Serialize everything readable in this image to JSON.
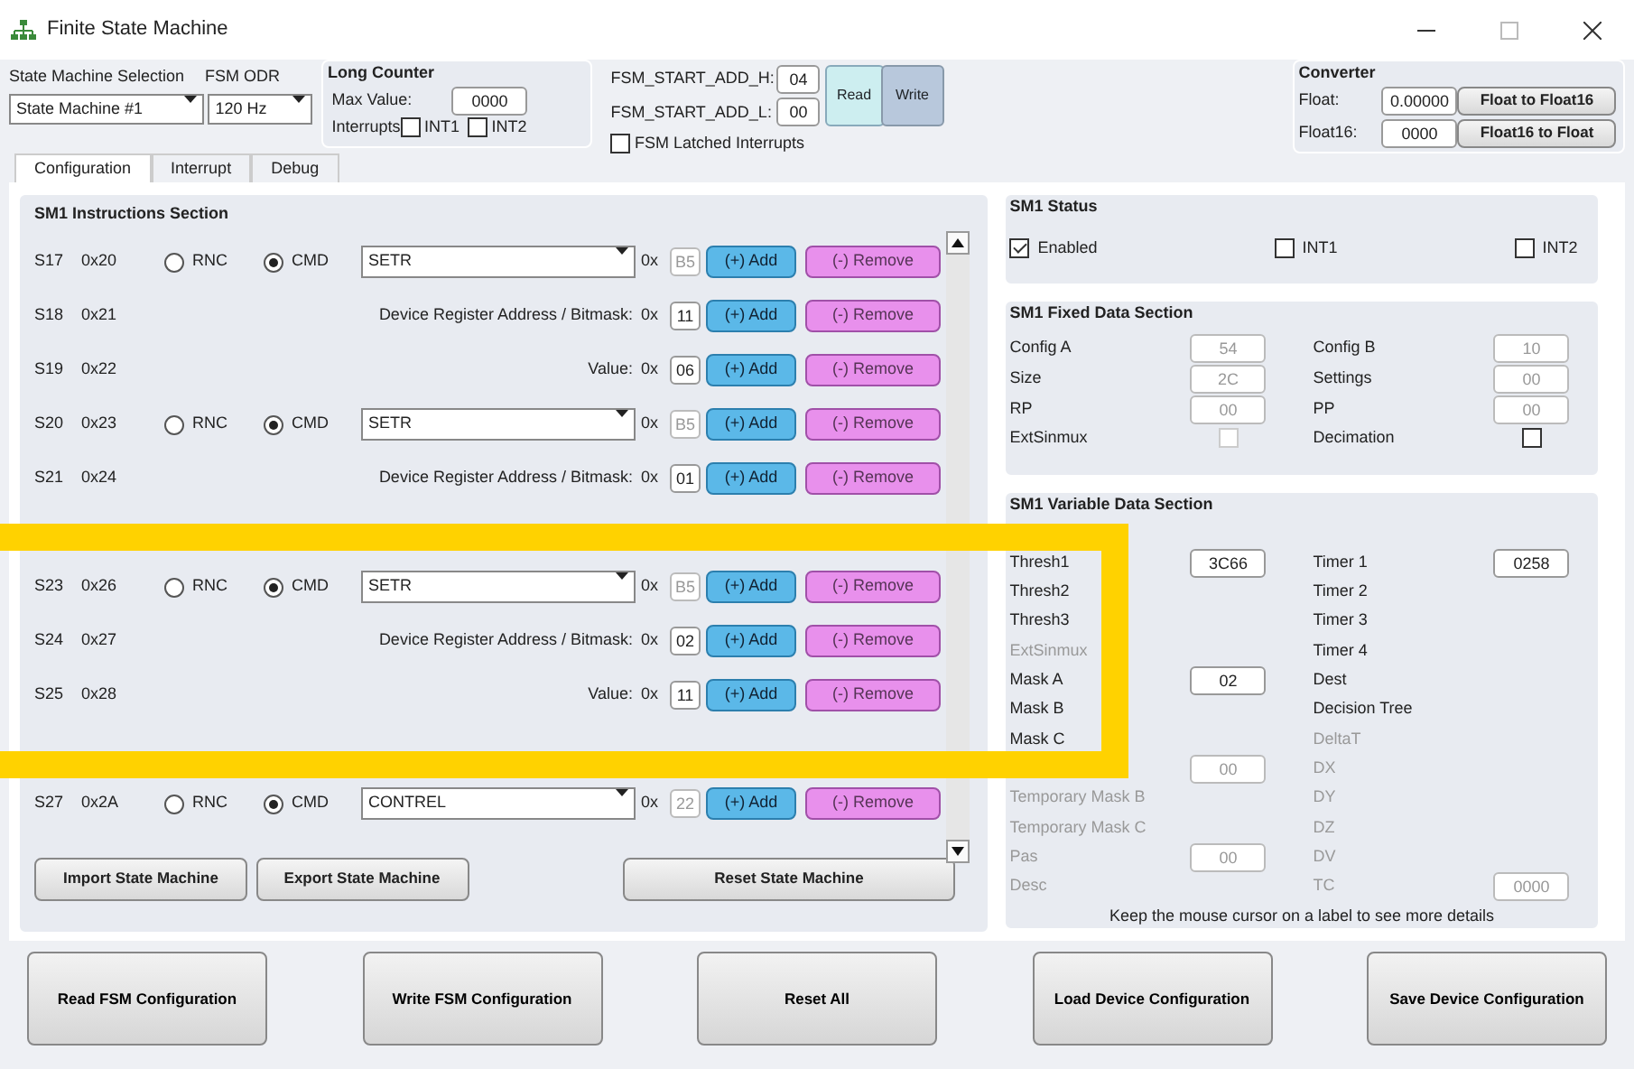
{
  "window": {
    "title": "Finite State Machine"
  },
  "top": {
    "sm_selection": {
      "label": "State Machine Selection",
      "value": "State Machine #1"
    },
    "odr": {
      "label": "FSM ODR",
      "value": "120 Hz"
    },
    "long_counter": {
      "title": "Long Counter",
      "max_label": "Max Value:",
      "max_value": "0000",
      "interrupts_label": "Interrupts",
      "checks": [
        {
          "label": "INT1",
          "checked": false
        },
        {
          "label": "INT2",
          "checked": false
        }
      ]
    },
    "fsm_start": {
      "fields": [
        {
          "label": "FSM_START_ADD_H:",
          "value": "04"
        },
        {
          "label": "FSM_START_ADD_L:",
          "value": "00"
        }
      ],
      "read_button": "Read",
      "write_button": "Write",
      "latched": {
        "label": "FSM Latched Interrupts",
        "checked": false
      }
    },
    "converter": {
      "title": "Converter",
      "rows": [
        {
          "label": "Float:",
          "value": "0.00000",
          "button": "Float to Float16"
        },
        {
          "label": "Float16:",
          "value": "0000",
          "button": "Float16 to Float"
        }
      ]
    }
  },
  "tabs": [
    {
      "label": "Configuration",
      "selected": true
    },
    {
      "label": "Interrupt",
      "selected": false
    },
    {
      "label": "Debug",
      "selected": false
    }
  ],
  "instructions": {
    "title": "SM1 Instructions Section",
    "rows": [
      {
        "kind": "cmd",
        "step": "S17",
        "addr": "0x20",
        "options": [
          {
            "label": "RNC",
            "selected": false
          },
          {
            "label": "CMD",
            "selected": true
          }
        ],
        "command": "SETR",
        "prefix": "0x",
        "code": "B5",
        "add": "(+) Add",
        "remove": "(-) Remove"
      },
      {
        "kind": "param",
        "step": "S18",
        "addr": "0x21",
        "label": "Device Register Address / Bitmask:",
        "prefix": "0x",
        "value": "11",
        "add": "(+) Add",
        "remove": "(-) Remove"
      },
      {
        "kind": "param",
        "step": "S19",
        "addr": "0x22",
        "label": "Value:",
        "prefix": "0x",
        "value": "06",
        "add": "(+) Add",
        "remove": "(-) Remove"
      },
      {
        "kind": "cmd",
        "step": "S20",
        "addr": "0x23",
        "options": [
          {
            "label": "RNC",
            "selected": false
          },
          {
            "label": "CMD",
            "selected": true
          }
        ],
        "command": "SETR",
        "prefix": "0x",
        "code": "B5",
        "add": "(+) Add",
        "remove": "(-) Remove"
      },
      {
        "kind": "param",
        "step": "S21",
        "addr": "0x24",
        "label": "Device Register Address / Bitmask:",
        "prefix": "0x",
        "value": "01",
        "add": "(+) Add",
        "remove": "(-) Remove"
      },
      {
        "kind": "covered"
      },
      {
        "kind": "cmd",
        "step": "S23",
        "addr": "0x26",
        "options": [
          {
            "label": "RNC",
            "selected": false
          },
          {
            "label": "CMD",
            "selected": true
          }
        ],
        "command": "SETR",
        "prefix": "0x",
        "code": "B5",
        "add": "(+) Add",
        "remove": "(-) Remove"
      },
      {
        "kind": "param",
        "step": "S24",
        "addr": "0x27",
        "label": "Device Register Address / Bitmask:",
        "prefix": "0x",
        "value": "02",
        "add": "(+) Add",
        "remove": "(-) Remove"
      },
      {
        "kind": "param",
        "step": "S25",
        "addr": "0x28",
        "label": "Value:",
        "prefix": "0x",
        "value": "11",
        "add": "(+) Add",
        "remove": "(-) Remove"
      },
      {
        "kind": "covered"
      },
      {
        "kind": "cmd",
        "step": "S27",
        "addr": "0x2A",
        "options": [
          {
            "label": "RNC",
            "selected": false
          },
          {
            "label": "CMD",
            "selected": true
          }
        ],
        "command": "CONTREL",
        "prefix": "0x",
        "code": "22",
        "add": "(+) Add",
        "remove": "(-) Remove"
      }
    ],
    "buttons": [
      "Import State Machine",
      "Export State Machine",
      "Reset State Machine"
    ]
  },
  "status": {
    "title": "SM1 Status",
    "checks": [
      {
        "label": "Enabled",
        "checked": true
      },
      {
        "label": "INT1",
        "checked": false
      },
      {
        "label": "INT2",
        "checked": false
      }
    ]
  },
  "fixed": {
    "title": "SM1 Fixed Data Section",
    "items": [
      {
        "kind": "field",
        "label": "Config A",
        "value": "54",
        "disabled": true
      },
      {
        "kind": "field",
        "label": "Config B",
        "value": "10",
        "disabled": true
      },
      {
        "kind": "field",
        "label": "Size",
        "value": "2C",
        "disabled": true
      },
      {
        "kind": "field",
        "label": "Settings",
        "value": "00",
        "disabled": true
      },
      {
        "kind": "field",
        "label": "RP",
        "value": "00",
        "disabled": true
      },
      {
        "kind": "field",
        "label": "PP",
        "value": "00",
        "disabled": true
      },
      {
        "kind": "check",
        "label": "ExtSinmux",
        "checked": false,
        "disabled": true
      },
      {
        "kind": "check",
        "label": "Decimation",
        "checked": false,
        "disabled": false
      }
    ]
  },
  "variable": {
    "title": "SM1 Variable Data Section",
    "items": [
      {
        "label": "Thresh1",
        "value": "3C66",
        "disabled": false
      },
      {
        "label": "Timer 1",
        "value": "0258",
        "disabled": false
      },
      {
        "label": "Thresh2",
        "disabled": false
      },
      {
        "label": "Timer 2",
        "disabled": false
      },
      {
        "label": "Thresh3",
        "disabled": false
      },
      {
        "label": "Timer 3",
        "disabled": false
      },
      {
        "label": "ExtSinmux",
        "disabled": true
      },
      {
        "label": "Timer 4",
        "disabled": false
      },
      {
        "label": "Mask A",
        "value": "02",
        "disabled": false
      },
      {
        "label": "Dest",
        "disabled": false
      },
      {
        "label": "Mask B",
        "disabled": false
      },
      {
        "label": "Decision Tree",
        "disabled": false
      },
      {
        "label": "Mask C",
        "disabled": false
      },
      {
        "label": "DeltaT",
        "disabled": true
      },
      {
        "value": "00",
        "disabled": true
      },
      {
        "label": "DX",
        "disabled": true
      },
      {
        "label": "Temporary Mask B",
        "disabled": true
      },
      {
        "label": "DY",
        "disabled": true
      },
      {
        "label": "Temporary Mask C",
        "disabled": true
      },
      {
        "label": "DZ",
        "disabled": true
      },
      {
        "label": "Pas",
        "value": "00",
        "disabled": true
      },
      {
        "label": "DV",
        "disabled": true
      },
      {
        "label": "Desc",
        "disabled": true
      },
      {
        "label": "TC",
        "value": "0000",
        "disabled": true
      }
    ],
    "note": "Keep the mouse cursor on a label to see more details"
  },
  "bottom_buttons": [
    "Read FSM Configuration",
    "Write FSM Configuration",
    "Reset All",
    "Load Device Configuration",
    "Save Device Configuration"
  ]
}
